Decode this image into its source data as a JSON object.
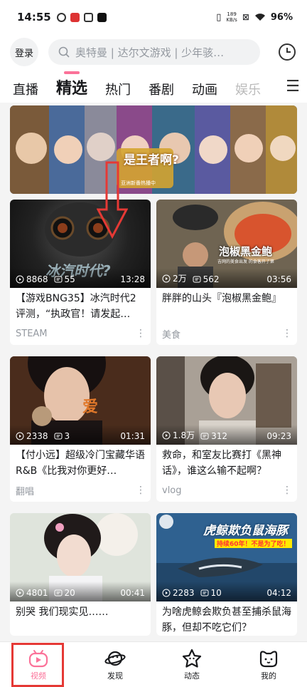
{
  "status_bar": {
    "time": "14:55",
    "network_speed": "189",
    "network_unit": "KB/s",
    "battery": "96%"
  },
  "header": {
    "login_label": "登录",
    "search_placeholder": "奥特曼 | 达尔文游戏 | 少年骇…",
    "icons": [
      "search-icon",
      "history-clock-icon"
    ]
  },
  "tabs": [
    {
      "label": "直播",
      "active": false
    },
    {
      "label": "精选",
      "active": true
    },
    {
      "label": "热门",
      "active": false
    },
    {
      "label": "番剧",
      "active": false
    },
    {
      "label": "动画",
      "active": false
    },
    {
      "label": "娱乐",
      "active": false
    }
  ],
  "menu_icon": "hamburger-menu-icon",
  "banner": {
    "caption": "是王者啊?",
    "subcaption": "亚洲新番热播中"
  },
  "videos": [
    {
      "thumb_text": "冰汽时代?",
      "plays": "8868",
      "comments": "55",
      "duration": "13:28",
      "title": "【游戏BNG35】冰汽时代2评测，“执政官！请发起…",
      "tag": "STEAM"
    },
    {
      "thumb_text": "泡椒黑金鲍",
      "thumb_subtext": "吉网的美食出发 的食客开了第",
      "plays": "2万",
      "comments": "562",
      "duration": "03:56",
      "title": "胖胖的山头『泡椒黑金鲍』",
      "tag": "美食"
    },
    {
      "thumb_text": "",
      "plays": "2338",
      "comments": "3",
      "duration": "01:31",
      "title": "【付小远】超级冷门宝藏华语R&B《比我对你更好…",
      "tag": "翻唱"
    },
    {
      "thumb_text": "",
      "plays": "1.8万",
      "comments": "312",
      "duration": "09:23",
      "title": "救命，和室友比赛打《黑神话》，谁这么输不起啊？",
      "tag": "vlog"
    },
    {
      "thumb_text": "",
      "plays": "4801",
      "comments": "20",
      "duration": "00:41",
      "title": "别哭 我们现实见……",
      "tag": ""
    },
    {
      "thumb_text": "虎鲸欺负鼠海豚",
      "thumb_subtext": "持续60年！不是为了吃！",
      "plays": "2283",
      "comments": "10",
      "duration": "04:12",
      "title": "为啥虎鲸会欺负甚至捕杀鼠海豚，但却不吃它们？",
      "tag": ""
    }
  ],
  "bottom_nav": [
    {
      "label": "视频",
      "icon": "video-tv-icon",
      "active": true
    },
    {
      "label": "发现",
      "icon": "planet-icon",
      "active": false
    },
    {
      "label": "动态",
      "icon": "star-icon",
      "active": false
    },
    {
      "label": "我的",
      "icon": "profile-tv-icon",
      "active": false
    }
  ],
  "colors": {
    "accent": "#fb7299",
    "annotation_red": "#e53935"
  }
}
